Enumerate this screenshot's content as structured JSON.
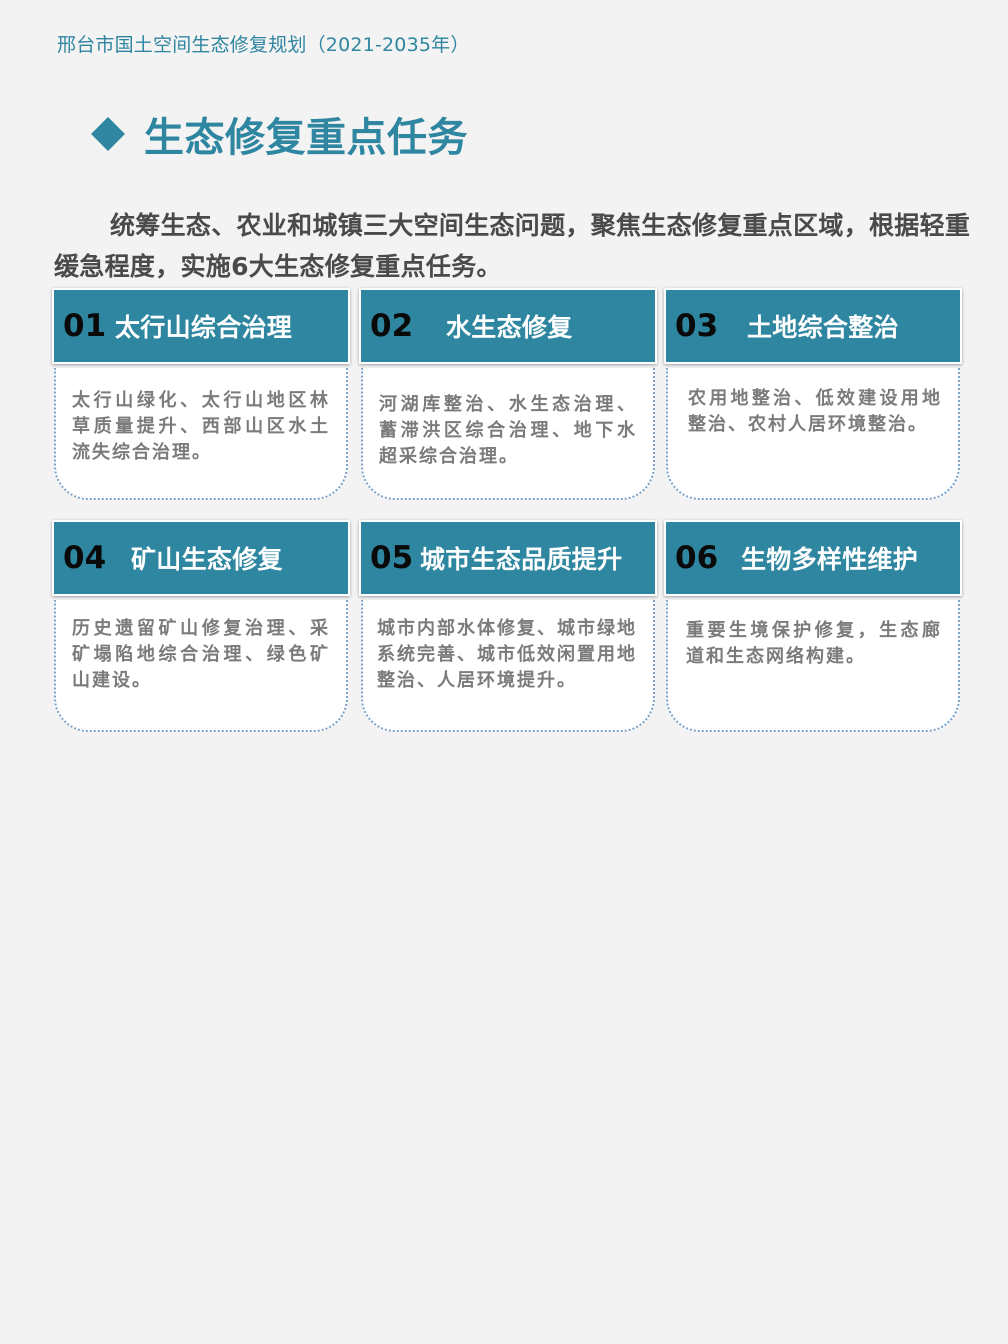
{
  "header": {
    "running_title": "邢台市国土空间生态修复规划（2021-2035年）"
  },
  "section": {
    "icon": "diamond-icon",
    "title": "生态修复重点任务",
    "intro": "统筹生态、农业和城镇三大空间生态问题，聚焦生态修复重点区域，根据轻重缓急程度，实施6大生态修复重点任务。"
  },
  "colors": {
    "accent": "#2e86a0",
    "text_dark": "#4a4a4a",
    "text_muted": "#7b7b7b",
    "background": "#f3f3f3"
  },
  "tasks": [
    {
      "num": "01",
      "title": "太行山综合治理",
      "desc": "太行山绿化、太行山地区林草质量提升、西部山区水土流失综合治理。"
    },
    {
      "num": "02",
      "title": "水生态修复",
      "desc": "河湖库整治、水生态治理、蓄滞洪区综合治理、地下水超采综合治理。"
    },
    {
      "num": "03",
      "title": "土地综合整治",
      "desc": "农用地整治、低效建设用地整治、农村人居环境整治。"
    },
    {
      "num": "04",
      "title": "矿山生态修复",
      "desc": "历史遗留矿山修复治理、采矿塌陷地综合治理、绿色矿山建设。"
    },
    {
      "num": "05",
      "title": "城市生态品质提升",
      "desc": "城市内部水体修复、城市绿地系统完善、城市低效闲置用地整治、人居环境提升。"
    },
    {
      "num": "06",
      "title": "生物多样性维护",
      "desc": "重要生境保护修复，生态廊道和生态网络构建。"
    }
  ]
}
